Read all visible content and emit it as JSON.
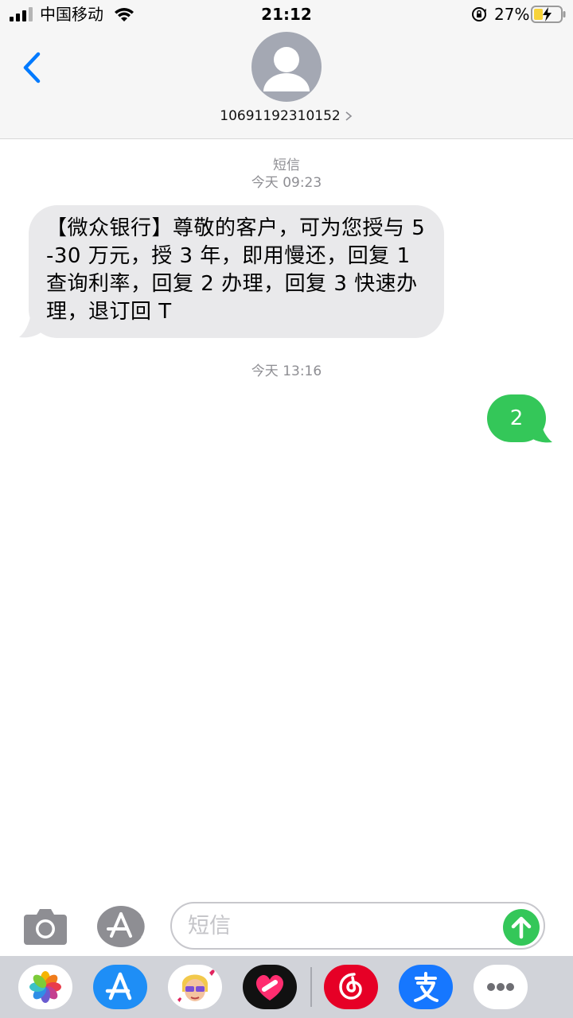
{
  "status_bar": {
    "carrier": "中国移动",
    "time": "21:12",
    "battery": "27%"
  },
  "header": {
    "back_icon": "chevron-left-icon",
    "avatar_icon": "person-icon",
    "contact": "10691192310152"
  },
  "messages": {
    "first_service": "短信",
    "first_time": "今天 09:23",
    "incoming_text": "【微众银行】尊敬的客户，可为您授与 5-30 万元，授 3 年，即用慢还，回复 1 查询利率，回复 2 办理，回复 3 快速办理，退订回 T",
    "second_time": "今天 13:16",
    "outgoing_text": "2"
  },
  "input_bar": {
    "placeholder": "短信",
    "camera_icon": "camera-icon",
    "appstore_icon": "app-store-icon",
    "send_icon": "arrow-up-icon"
  },
  "drawer": {
    "apps": [
      "photos-icon",
      "app-store-icon",
      "memoji-icon",
      "digital-touch-icon",
      "netease-music-icon",
      "alipay-icon",
      "more-icon"
    ]
  },
  "colors": {
    "accent_blue": "#007aff",
    "bubble_green": "#34c759",
    "bubble_gray": "#e9e9eb",
    "meta_gray": "#8e8e93"
  }
}
